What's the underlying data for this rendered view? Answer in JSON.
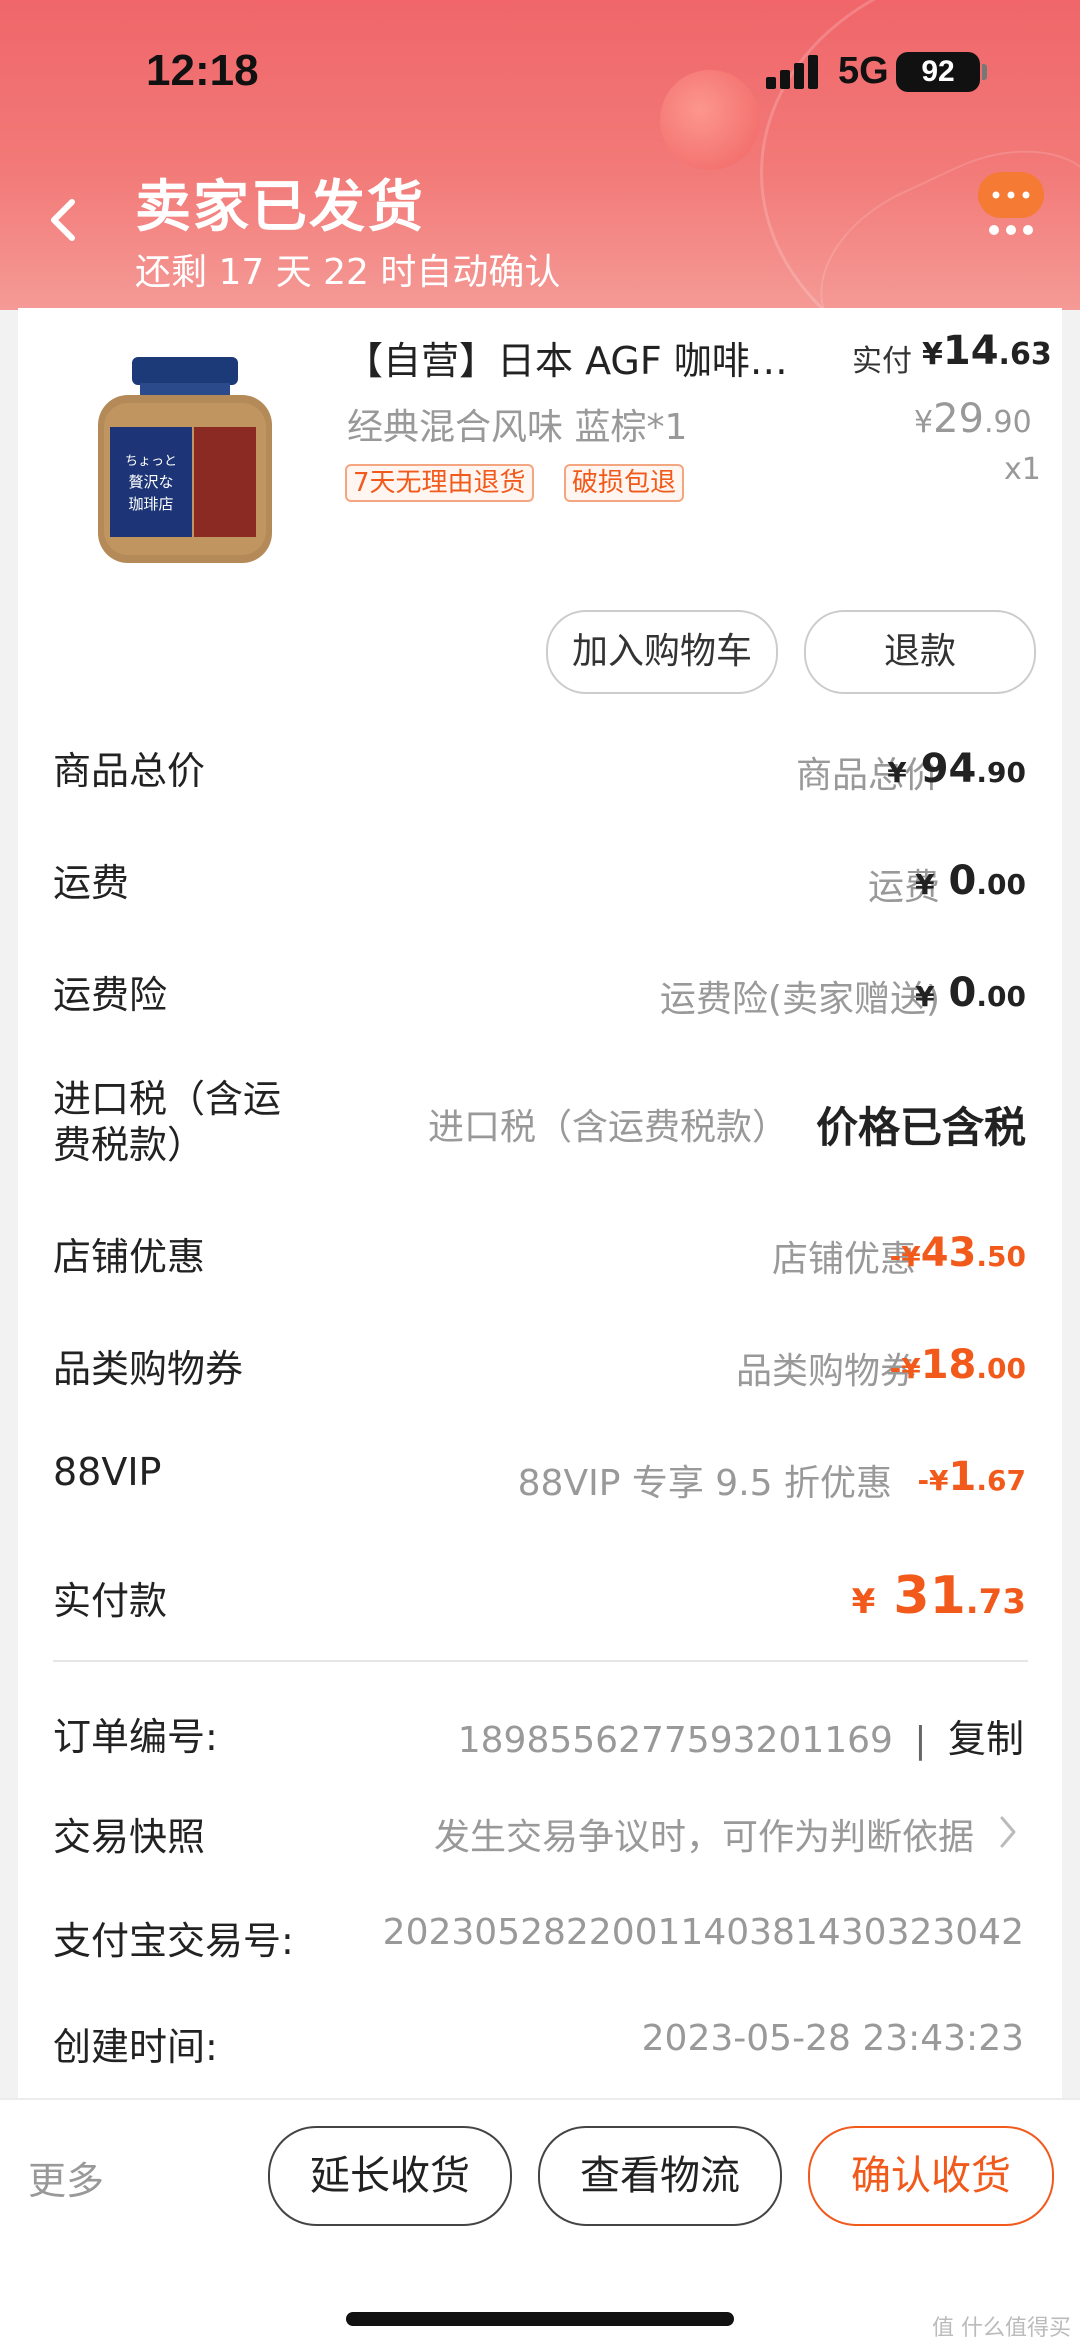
{
  "status_bar": {
    "time": "12:18",
    "network": "5G",
    "battery": "92"
  },
  "header": {
    "title": "卖家已发货",
    "subtitle": "还剩 17 天 22 时自动确认"
  },
  "product": {
    "name": "【自营】日本 AGF 咖啡…",
    "variant": "经典混合风味 蓝棕*1",
    "tags": [
      "7天无理由退货",
      "破损包退"
    ],
    "paid_label": "实付",
    "paid_yen": "¥",
    "paid_int": "14",
    "paid_dec": ".63",
    "orig_yen": "¥",
    "orig_int": "29",
    "orig_dec": ".90",
    "qty": "x1"
  },
  "actions": {
    "add_cart": "加入购物车",
    "refund": "退款"
  },
  "costs": [
    {
      "label": "商品总价",
      "desc": "商品总价",
      "sign": "¥",
      "int": "94",
      "dec": ".90"
    },
    {
      "label": "运费",
      "desc": "运费",
      "sign": "¥",
      "int": "0",
      "dec": ".00"
    },
    {
      "label": "运费险",
      "desc": "运费险(卖家赠送)",
      "sign": "¥",
      "int": "0",
      "dec": ".00"
    },
    {
      "label_line1": "进口税（含运",
      "label_line2": "费税款）",
      "desc": "进口税（含运费税款）",
      "value": "价格已含税"
    },
    {
      "label": "店铺优惠",
      "desc": "店铺优惠",
      "sign": "-¥",
      "int": "43",
      "dec": ".50"
    },
    {
      "label": "品类购物券",
      "desc": "品类购物券",
      "sign": "-¥",
      "int": "18",
      "dec": ".00"
    },
    {
      "label": "88VIP",
      "desc": "88VIP 专享 9.5 折优惠",
      "sign": "-¥",
      "int": "1",
      "dec": ".67"
    }
  ],
  "total": {
    "label": "实付款",
    "sign": "¥",
    "int": "31",
    "dec": ".73"
  },
  "order_info": {
    "order_no_label": "订单编号:",
    "order_no": "1898556277593201169",
    "sep": "|",
    "copy": "复制",
    "snapshot_label": "交易快照",
    "snapshot_desc": "发生交易争议时，可作为判断依据",
    "alipay_label": "支付宝交易号:",
    "alipay_no": "2023052822001140381430323042",
    "created_label": "创建时间:",
    "created_at": "2023-05-28 23:43:23"
  },
  "bottom_bar": {
    "more": "更多",
    "extend": "延长收货",
    "logistics": "查看物流",
    "confirm": "确认收货"
  },
  "watermark": "值 什么值得买",
  "colors": {
    "header": "#f0666a",
    "accent": "#f25a1c"
  }
}
